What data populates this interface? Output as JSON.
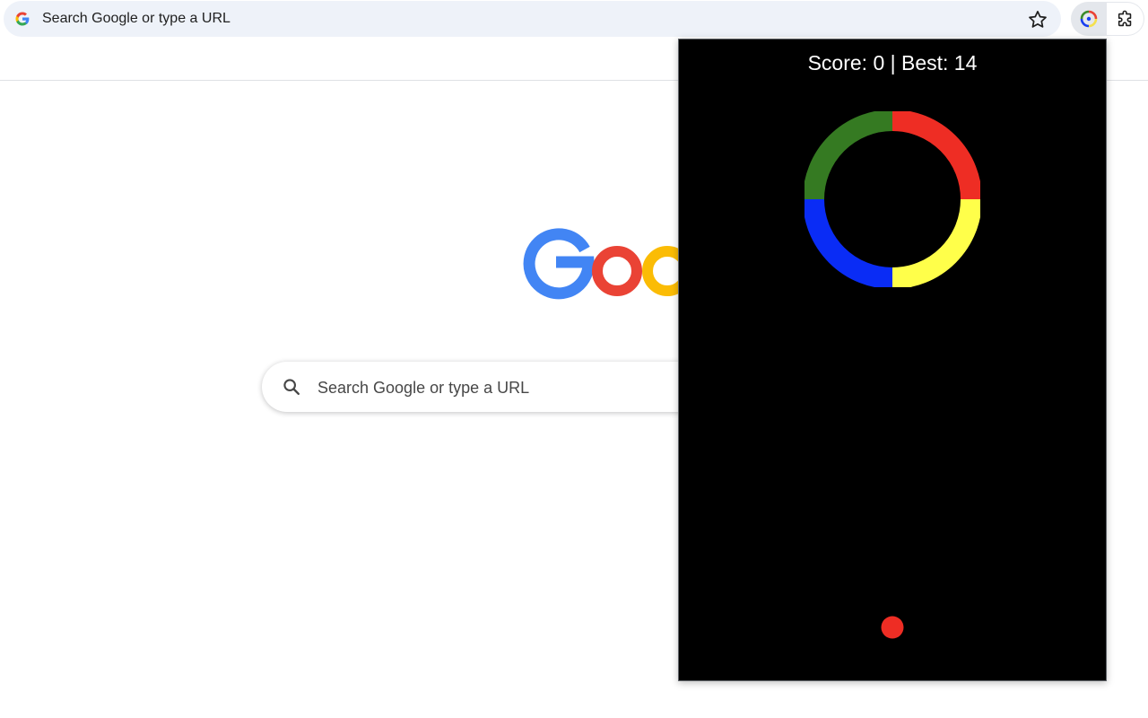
{
  "omnibox": {
    "text": "Search Google or type a URL"
  },
  "toolbar": {
    "star_icon": "star-icon",
    "extension_icon": "color-ring-extension-icon",
    "extensions_menu_icon": "puzzle-icon"
  },
  "ntp": {
    "logo_text": "Google",
    "search_placeholder": "Search Google or type a URL"
  },
  "game": {
    "score_text": "Score: 0 | Best: 14",
    "score": 0,
    "best": 14,
    "ring_colors": {
      "top_right": "#ee2d24",
      "bottom_right": "#ffff4a",
      "bottom_left": "#0a2cf5",
      "top_left": "#357a22"
    },
    "ball_color": "#ee2d24",
    "background": "#000000"
  }
}
